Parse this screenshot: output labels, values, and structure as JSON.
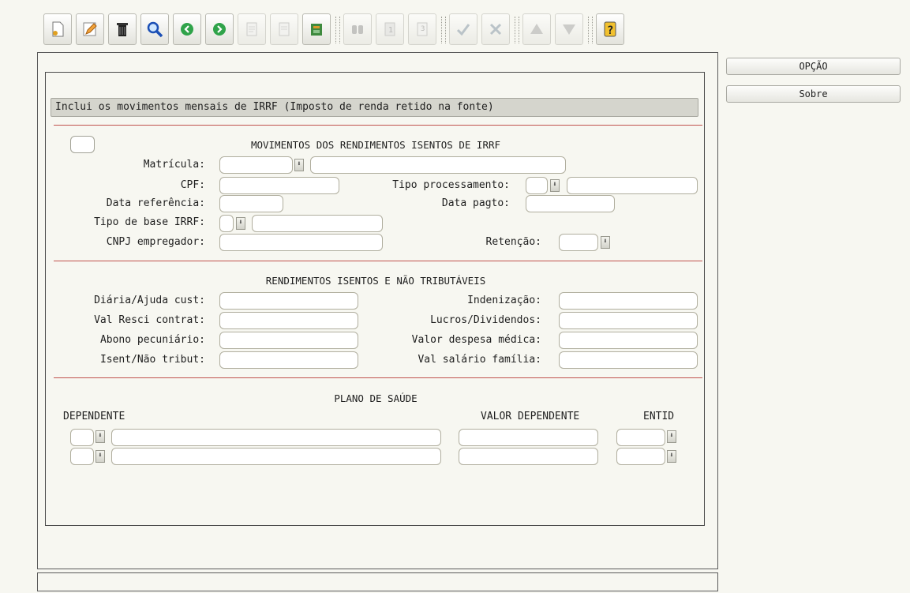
{
  "toolbar": {
    "buttons": [
      {
        "name": "new-icon",
        "state": "enabled"
      },
      {
        "name": "edit-pencil-icon",
        "state": "enabled"
      },
      {
        "name": "delete-trash-icon",
        "state": "enabled"
      },
      {
        "name": "search-magnifier-icon",
        "state": "enabled"
      },
      {
        "name": "previous-record-icon",
        "state": "enabled"
      },
      {
        "name": "next-record-icon",
        "state": "enabled"
      },
      {
        "name": "print-icon",
        "state": "disabled"
      },
      {
        "name": "print-preview-icon",
        "state": "disabled"
      },
      {
        "name": "export-icon",
        "state": "enabled"
      },
      {
        "name": "binoculars-icon",
        "state": "disabled"
      },
      {
        "name": "page-one-icon",
        "state": "disabled"
      },
      {
        "name": "page-three-icon",
        "state": "disabled"
      },
      {
        "name": "confirm-check-icon",
        "state": "disabled"
      },
      {
        "name": "cancel-tools-icon",
        "state": "disabled"
      },
      {
        "name": "up-triangle-icon",
        "state": "disabled"
      },
      {
        "name": "down-triangle-icon",
        "state": "disabled"
      },
      {
        "name": "help-question-icon",
        "state": "enabled"
      }
    ]
  },
  "side": {
    "option_label": "OPÇÃO",
    "about_label": "Sobre"
  },
  "description": "Inclui os movimentos mensais de IRRF (Imposto de renda retido na fonte)",
  "section1": {
    "title": "MOVIMENTOS DOS RENDIMENTOS ISENTOS DE IRRF",
    "matricula_label": "Matrícula:",
    "cpf_label": "CPF:",
    "tipo_processamento_label": "Tipo processamento:",
    "data_referencia_label": "Data referência:",
    "data_pagto_label": "Data pagto:",
    "tipo_base_label": "Tipo de base IRRF:",
    "cnpj_label": "CNPJ empregador:",
    "retencao_label": "Retenção:"
  },
  "section2": {
    "title": "RENDIMENTOS ISENTOS E NÃO TRIBUTÁVEIS",
    "diaria_label": "Diária/Ajuda cust:",
    "indenizacao_label": "Indenização:",
    "val_resci_label": "Val Resci contrat:",
    "lucros_label": "Lucros/Dividendos:",
    "abono_label": "Abono pecuniário:",
    "despesa_medica_label": "Valor despesa médica:",
    "isent_label": "Isent/Não tribut:",
    "salario_familia_label": "Val salário família:"
  },
  "section3": {
    "title": "PLANO DE SAÚDE",
    "col_dependente": "DEPENDENTE",
    "col_valor": "VALOR DEPENDENTE",
    "col_entid": "ENTID"
  },
  "colors": {
    "background": "#f7f7f1",
    "separator": "#c0524e",
    "desc_bar": "#d5d5cd"
  }
}
